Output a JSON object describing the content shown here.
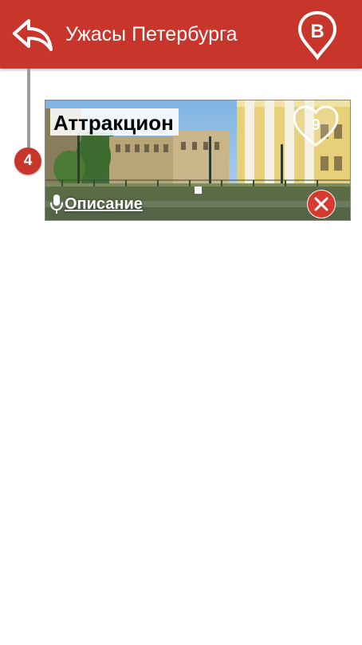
{
  "header": {
    "title": "Ужасы Петербурга",
    "back_icon": "reply-arrow-icon",
    "brand_icon": "b-location-pin-icon",
    "background_color": "#c8352a"
  },
  "timeline": {
    "step_number": "4"
  },
  "card": {
    "title": "Аттракцион",
    "favorite_count": "9",
    "description_link": "Описание",
    "photo_subject": "canal-bridge-photo",
    "mic_icon": "microphone-icon",
    "close_icon": "close-circle-icon"
  }
}
